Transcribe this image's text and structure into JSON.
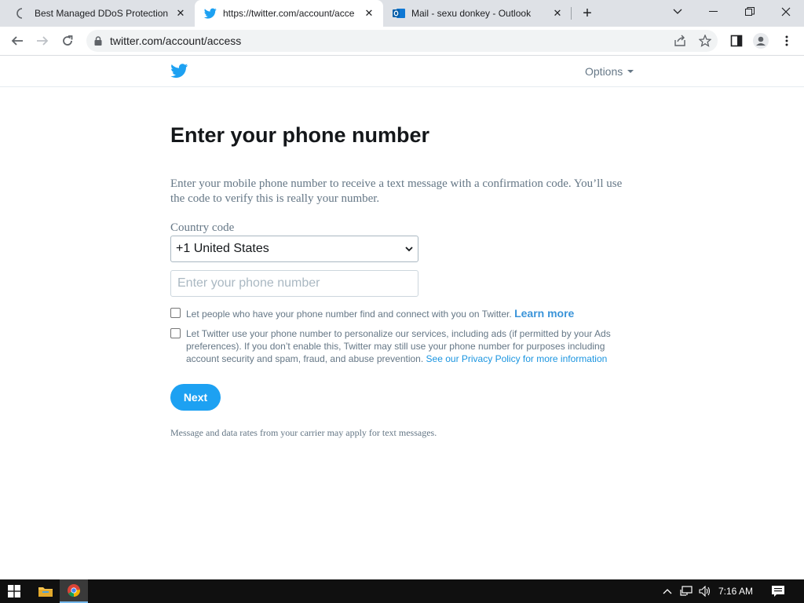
{
  "browser": {
    "tabs": [
      {
        "title": "Best Managed DDoS Protection a",
        "favicon": "loading-spinner-icon",
        "active": false
      },
      {
        "title": "https://twitter.com/account/acce",
        "favicon": "twitter-bird-icon",
        "active": true
      },
      {
        "title": "Mail - sexu donkey - Outlook",
        "favicon": "outlook-icon",
        "active": false
      }
    ],
    "url": "twitter.com/account/access"
  },
  "header": {
    "options_label": "Options"
  },
  "main": {
    "title": "Enter your phone number",
    "description": "Enter your mobile phone number to receive a text message with a confirmation code. You’ll use the code to verify this is really your number.",
    "country_label": "Country code",
    "country_value": "+1 United States",
    "phone_placeholder": "Enter your phone number",
    "phone_value": "",
    "discover_text": "Let people who have your phone number find and connect with you on Twitter.",
    "learn_more": "Learn more",
    "personalize_text": "Let Twitter use your phone number to personalize our services, including ads (if permitted by your Ads preferences). If you don’t enable this, Twitter may still use your phone number for purposes including account security and spam, fraud, and abuse prevention.",
    "privacy_link": "See our Privacy Policy for more information",
    "next_label": "Next",
    "footnote": "Message and data rates from your carrier may apply for text messages."
  },
  "taskbar": {
    "time": "7:16 AM"
  },
  "colors": {
    "twitter_blue": "#1da1f2",
    "link_blue": "#1b95e0",
    "muted_text": "#657786",
    "title_text": "#14171a"
  }
}
